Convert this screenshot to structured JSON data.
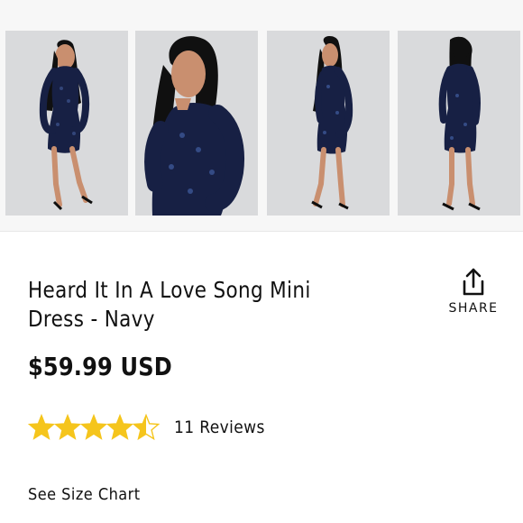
{
  "product": {
    "title": "Heard It In A Love Song Mini Dress - Navy",
    "price": "$59.99 USD",
    "rating": {
      "value": 4.5,
      "max": 5,
      "reviews_label": "11 Reviews"
    },
    "size_chart_label": "See Size Chart"
  },
  "gallery": [
    {
      "image": "model-front-full-length"
    },
    {
      "image": "model-front-close-up"
    },
    {
      "image": "model-side-full-length"
    },
    {
      "image": "model-back-full-length"
    }
  ],
  "share": {
    "label": "SHARE",
    "icon": "share-icon"
  },
  "colors": {
    "star": "#f5c51c",
    "dress": "#172044",
    "skin": "#c98f6f",
    "background": "#d9dadc",
    "text": "#111111"
  }
}
